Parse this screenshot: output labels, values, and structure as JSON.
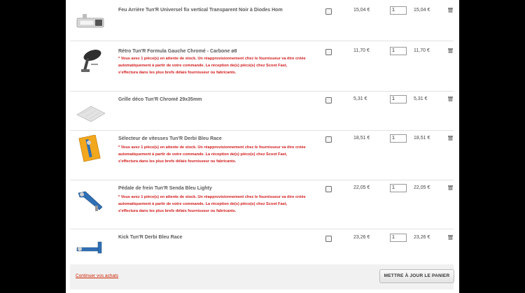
{
  "cart": {
    "items": [
      {
        "name": "Feu Arrière Tun'R Universel fix vertical Transparent Noir à Diodes Hom",
        "notice": "",
        "unit_price": "15,04 €",
        "quantity": "1",
        "total": "15,04 €",
        "image_icon": "tail-light-image"
      },
      {
        "name": "Rétro Tun'R Formula Gauche Chromé - Carbone ø8",
        "notice": "* Vous avez 1 pièce(s) en attente de stock. Un réapprovisionnement chez le fournisseur va être créée automatiquement à partir de votre commande. La réception de(s) pièce(s) chez Scoot Fast, s'effectura dans les plus brefs délais fournisseur ou fabricants.",
        "unit_price": "11,70 €",
        "quantity": "1",
        "total": "11,70 €",
        "image_icon": "mirror-image"
      },
      {
        "name": "Grille déco Tun'R Chromé 29x35mm",
        "notice": "",
        "unit_price": "5,31 €",
        "quantity": "1",
        "total": "5,31 €",
        "image_icon": "grille-image"
      },
      {
        "name": "Sélecteur de vitesses Tun'R Derbi Bleu Race",
        "notice": "* Vous avez 1 pièce(s) en attente de stock. Un réapprovisionnement chez le fournisseur va être créée automatiquement à partir de votre commande. La réception de(s) pièce(s) chez Scoot Fast, s'effectura dans les plus brefs délais fournisseur ou fabricants.",
        "unit_price": "18,51 €",
        "quantity": "1",
        "total": "18,51 €",
        "image_icon": "gear-selector-image"
      },
      {
        "name": "Pédale de frein Tun'R Senda Bleu Lighty",
        "notice": "* Vous avez 1 pièce(s) en attente de stock. Un réapprovisionnement chez le fournisseur va être créée automatiquement à partir de votre commande. La réception de(s) pièce(s) chez Scoot Fast, s'effectura dans les plus brefs délais fournisseur ou fabricants.",
        "unit_price": "22,05 €",
        "quantity": "1",
        "total": "22,05 €",
        "image_icon": "brake-pedal-image"
      },
      {
        "name": "Kick Tun'R Derbi Bleu Race",
        "notice": "",
        "unit_price": "23,26 €",
        "quantity": "1",
        "total": "23,26 €",
        "image_icon": "kickstarter-image"
      }
    ],
    "continue_label": "Continuer vos achats",
    "update_label": "METTRE À JOUR LE PANIER",
    "colors": {
      "notice": "#d11a1a",
      "link": "#cc2200",
      "background": "#000000"
    }
  }
}
